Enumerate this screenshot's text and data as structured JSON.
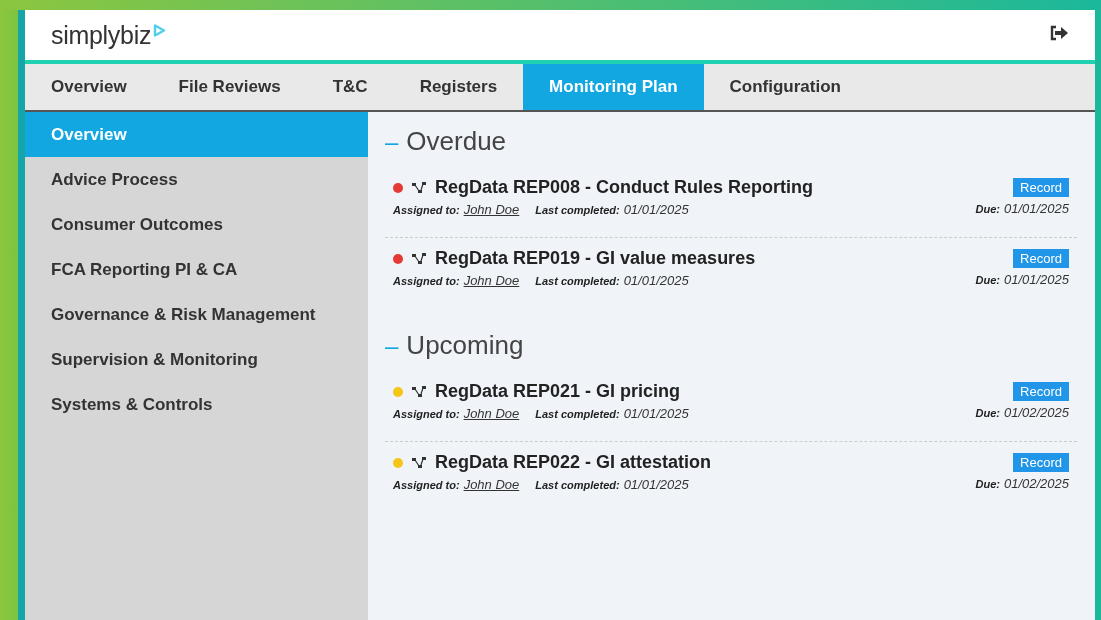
{
  "header": {
    "logo": "simplybiz"
  },
  "tabs": [
    {
      "label": "Overview",
      "selected": false
    },
    {
      "label": "File Reviews",
      "selected": false
    },
    {
      "label": "T&C",
      "selected": false
    },
    {
      "label": "Registers",
      "selected": false
    },
    {
      "label": "Monitoring Plan",
      "selected": true
    },
    {
      "label": "Configuration",
      "selected": false
    }
  ],
  "sidebar": {
    "items": [
      {
        "label": "Overview",
        "selected": true
      },
      {
        "label": "Advice Process",
        "selected": false
      },
      {
        "label": "Consumer Outcomes",
        "selected": false
      },
      {
        "label": "FCA Reporting PI & CA",
        "selected": false
      },
      {
        "label": "Governance & Risk Management",
        "selected": false
      },
      {
        "label": "Supervision & Monitoring",
        "selected": false
      },
      {
        "label": "Systems & Controls",
        "selected": false
      }
    ]
  },
  "sections": [
    {
      "marker": "–",
      "title": "Overdue",
      "items": [
        {
          "color": "#e53935",
          "title": "RegData REP008 - Conduct Rules Reporting",
          "assigned_label": "Assigned to:",
          "assignee": "John Doe",
          "completed_label": "Last completed:",
          "completed": "01/01/2025",
          "button": "Record",
          "due_label": "Due:",
          "due": "01/01/2025"
        },
        {
          "color": "#e53935",
          "title": "RegData REP019 - GI value measures",
          "assigned_label": "Assigned to:",
          "assignee": "John Doe",
          "completed_label": "Last completed:",
          "completed": "01/01/2025",
          "button": "Record",
          "due_label": "Due:",
          "due": "01/01/2025"
        }
      ]
    },
    {
      "marker": "–",
      "title": "Upcoming",
      "items": [
        {
          "color": "#f5c518",
          "title": "RegData REP021 - GI pricing",
          "assigned_label": "Assigned to:",
          "assignee": "John Doe",
          "completed_label": "Last completed:",
          "completed": "01/01/2025",
          "button": "Record",
          "due_label": "Due:",
          "due": "01/02/2025"
        },
        {
          "color": "#f5c518",
          "title": "RegData REP022 - GI attestation",
          "assigned_label": "Assigned to:",
          "assignee": "John Doe",
          "completed_label": "Last completed:",
          "completed": "01/01/2025",
          "button": "Record",
          "due_label": "Due:",
          "due": "01/02/2025"
        }
      ]
    }
  ]
}
